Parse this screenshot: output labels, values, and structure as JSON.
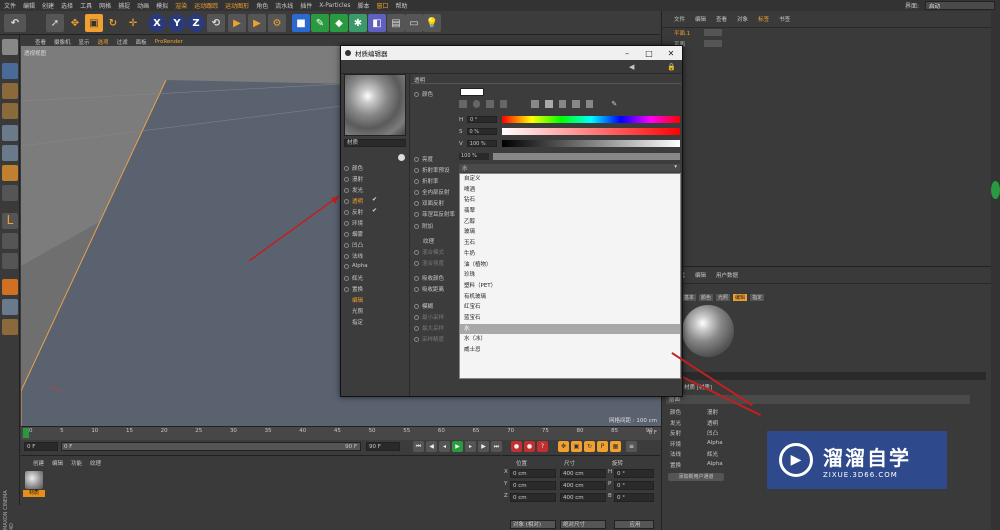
{
  "menubar": {
    "items": [
      "文件",
      "编辑",
      "创建",
      "选择",
      "工具",
      "网格",
      "捕捉",
      "动画",
      "模拟",
      "渲染",
      "运动跟踪",
      "运动图形",
      "角色",
      "流水线",
      "插件",
      "X-Particles",
      "脚本",
      "窗口",
      "帮助"
    ],
    "layout_label": "界面:",
    "layout_value": "启动"
  },
  "viewport": {
    "menu": [
      "查看",
      "摄像机",
      "显示",
      "选项",
      "过滤",
      "面板",
      "ProRender"
    ],
    "label": "透视视图",
    "footer": "网格间距 : 100 cm"
  },
  "timeline": {
    "ticks": [
      "0",
      "5",
      "10",
      "15",
      "20",
      "25",
      "30",
      "35",
      "40",
      "45",
      "50",
      "55",
      "60",
      "65",
      "70",
      "75",
      "80",
      "85",
      "90"
    ],
    "end_label": "0 F",
    "start_frame": "0 F",
    "current_frame": "0 F",
    "end_frame": "90 F",
    "end_frame2": "90 F"
  },
  "material_manager": {
    "tabs": [
      "创建",
      "编辑",
      "功能",
      "纹理"
    ],
    "material_name": "材质",
    "brand": "MAXON CINEMA 4D"
  },
  "coords": {
    "headers": [
      "位置",
      "尺寸",
      "旋转"
    ],
    "rows": [
      {
        "axis": "X",
        "pos": "0 cm",
        "size": "400 cm",
        "rot_axis": "H",
        "rot": "0 °"
      },
      {
        "axis": "Y",
        "pos": "0 cm",
        "size": "400 cm",
        "rot_axis": "P",
        "rot": "0 °"
      },
      {
        "axis": "Z",
        "pos": "0 cm",
        "size": "400 cm",
        "rot_axis": "B",
        "rot": "0 °"
      }
    ],
    "mode": "对象 (相对)",
    "size_mode": "绝对尺寸",
    "apply": "应用"
  },
  "object_panel": {
    "tabs": [
      "文件",
      "编辑",
      "查看",
      "对象",
      "标签",
      "书签"
    ],
    "objects": [
      "平面.1",
      "平面"
    ]
  },
  "attr_panel": {
    "tabs": [
      "模式",
      "编辑",
      "用户数据"
    ],
    "subtabs": [
      "基本",
      "颜色",
      "光照",
      "编辑",
      "指定"
    ],
    "title": "材质 [材质]",
    "name_label": "材质",
    "search": "层面",
    "channels_left": [
      "颜色",
      "发光",
      "反射",
      "环境",
      "法线",
      "置换"
    ],
    "channels_right": [
      "漫射",
      "透明",
      "凹凸",
      "Alpha",
      "辉光",
      "Alpha"
    ],
    "add_button": "添加新用户通道"
  },
  "dialog": {
    "title": "材质编辑器",
    "material_name": "材质",
    "section": "透明",
    "channels": [
      {
        "label": "颜色",
        "checked": false,
        "active": false
      },
      {
        "label": "漫射",
        "checked": false,
        "active": false
      },
      {
        "label": "发光",
        "checked": false,
        "active": false
      },
      {
        "label": "透明",
        "checked": true,
        "active": true
      },
      {
        "label": "反射",
        "checked": true,
        "active": false
      },
      {
        "label": "环境",
        "checked": false,
        "active": false
      },
      {
        "label": "烟雾",
        "checked": false,
        "active": false
      },
      {
        "label": "凹凸",
        "checked": false,
        "active": false
      },
      {
        "label": "法线",
        "checked": false,
        "active": false
      },
      {
        "label": "Alpha",
        "checked": false,
        "active": false
      },
      {
        "label": "辉光",
        "checked": false,
        "active": false
      },
      {
        "label": "置换",
        "checked": false,
        "active": false
      }
    ],
    "sub_channels": [
      "编辑",
      "光照",
      "指定"
    ],
    "props": {
      "color": "颜色",
      "h_label": "H",
      "h_value": "0 °",
      "s_label": "S",
      "s_value": "0 %",
      "v_label": "V",
      "v_value": "100 %",
      "brightness_label": "亮度",
      "brightness_value": "100 %",
      "ior_preset_label": "折射率预设",
      "ior_preset_value": "水",
      "ior_label": "折射率",
      "total_internal": "全内部反射",
      "double_reflection": "双面反射",
      "fresnel": "菲涅耳反射率",
      "additive": "附加",
      "texture": "纹理",
      "mix_mode": "混合模式",
      "mix_strength": "混合强度",
      "absorb_color": "吸收颜色",
      "absorb_distance": "吸收距离",
      "blur": "模糊",
      "min_samples": "最小采样",
      "max_samples": "最大采样",
      "accuracy": "采样精度"
    },
    "dropdown": {
      "items": [
        "自定义",
        "啤酒",
        "钻石",
        "翡翠",
        "乙醇",
        "玻璃",
        "玉石",
        "牛奶",
        "油（植物）",
        "珍珠",
        "塑料（PET）",
        "有机玻璃",
        "红宝石",
        "蓝宝石",
        "水",
        "水（冰）",
        "威士忌"
      ],
      "selected_index": 14
    }
  },
  "watermark": {
    "title": "溜溜自学",
    "url": "ZIXUE.3D66.COM"
  },
  "colors": {
    "accent": "#f0a030",
    "viewport_floor": "#5a6270",
    "arrow": "#c02020",
    "watermark_bg": "#2e4a8c"
  }
}
